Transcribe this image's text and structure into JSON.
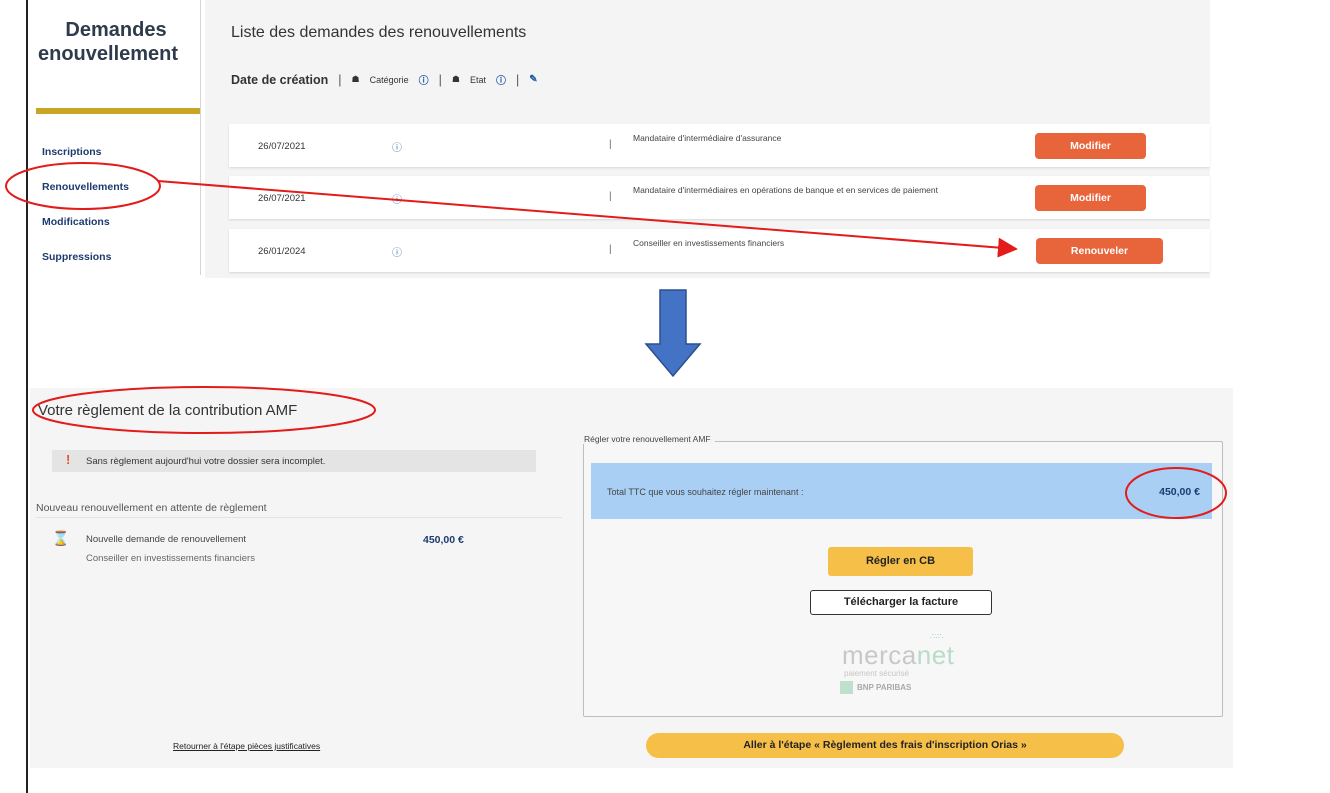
{
  "sidebar": {
    "title_line1": "Demandes",
    "title_line2": "enouvellement",
    "items": [
      {
        "label": "Inscriptions"
      },
      {
        "label": "Renouvellements"
      },
      {
        "label": "Modifications"
      },
      {
        "label": "Suppressions"
      }
    ]
  },
  "list": {
    "title": "Liste des demandes des renouvellements",
    "filters": {
      "date": "Date de création",
      "category": "Catégorie",
      "state": "Etat",
      "separator": "|"
    },
    "rows": [
      {
        "date": "26/07/2021",
        "category": "Mandataire d'intermédiaire d'assurance",
        "action": "Modifier"
      },
      {
        "date": "26/07/2021",
        "category": "Mandataire d'intermédiaires en opérations de banque et en services de paiement",
        "action": "Modifier"
      },
      {
        "date": "26/01/2024",
        "category": "Conseiller en investissements financiers",
        "action": "Renouveler"
      }
    ]
  },
  "payment": {
    "title": "Votre règlement de la contribution AMF",
    "warning": "Sans règlement aujourd'hui votre dossier sera incomplet.",
    "pending_heading": "Nouveau renouvellement en attente de règlement",
    "pending_item": {
      "title": "Nouvelle demande de renouvellement",
      "subtitle": "Conseiller en investissements financiers",
      "amount": "450,00 €"
    },
    "box_legend": "Régler votre renouvellement AMF",
    "total_label": "Total TTC que vous souhaitez régler maintenant :",
    "total_amount": "450,00 €",
    "pay_cb_label": "Régler en CB",
    "download_label": "Télécharger la facture",
    "mercanet": {
      "brand": "mercanet",
      "tagline": "paiement sécurisé",
      "bank": "BNP PARIBAS"
    },
    "back_link": "Retourner à l'étape pièces justificatives",
    "next_button": "Aller à l'étape « Règlement des frais d'inscription Orias »"
  },
  "colors": {
    "action_orange": "#e8643b",
    "primary_yellow": "#f6bf48",
    "highlight_blue": "#a9cff5",
    "annotation_red": "#e31b1b",
    "arrow_blue": "#4472c4"
  }
}
